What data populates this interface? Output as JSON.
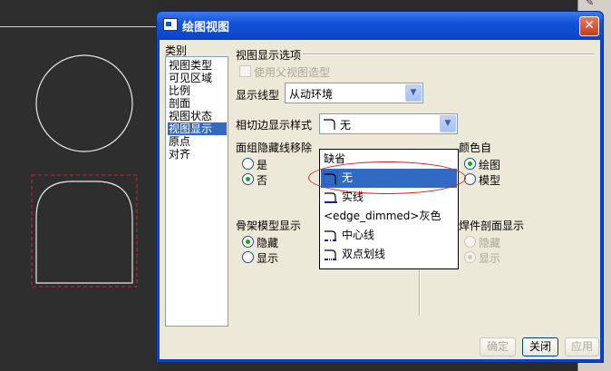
{
  "window": {
    "title": "绘图视图",
    "close_glyph": "✕"
  },
  "categories": {
    "label": "类别",
    "items": [
      "视图类型",
      "可见区域",
      "比例",
      "剖面",
      "视图状态",
      "视图显示",
      "原点",
      "对齐"
    ],
    "selected_index": 5
  },
  "display_options": {
    "section_title": "视图显示选项",
    "use_parent_label": "使用父视图造型",
    "line_style_label": "显示线型",
    "line_style_value": "从动环境",
    "tangent_label": "相切边显示样式",
    "tangent_value": "无",
    "hidden_remove_label": "面组隐藏线移除",
    "yes_label": "是",
    "no_label": "否",
    "color_from_label": "颜色自",
    "color_drawing_label": "绘图",
    "color_model_label": "模型",
    "skeleton_label": "骨架模型显示",
    "skeleton_hide_label": "隐藏",
    "skeleton_show_label": "显示",
    "weld_label": "焊件剖面显示",
    "weld_hide_label": "隐藏",
    "weld_show_label": "显示"
  },
  "tangent_dropdown": {
    "items": [
      {
        "label": "缺省",
        "icon": ""
      },
      {
        "label": "无",
        "icon": "no-tangent-icon"
      },
      {
        "label": "实线",
        "icon": "solid-tangent-icon"
      },
      {
        "label": "<edge_dimmed>灰色",
        "icon": ""
      },
      {
        "label": "中心线",
        "icon": "centerline-tangent-icon"
      },
      {
        "label": "双点划线",
        "icon": "phantom-tangent-icon"
      }
    ],
    "selected_index": 1
  },
  "buttons": {
    "ok": "确定",
    "close": "关闭",
    "apply": "应用"
  },
  "colors": {
    "title_bar": "#0a45c8",
    "selection": "#316ac5",
    "annotation": "#d02020",
    "radio_dot": "#21a121"
  }
}
